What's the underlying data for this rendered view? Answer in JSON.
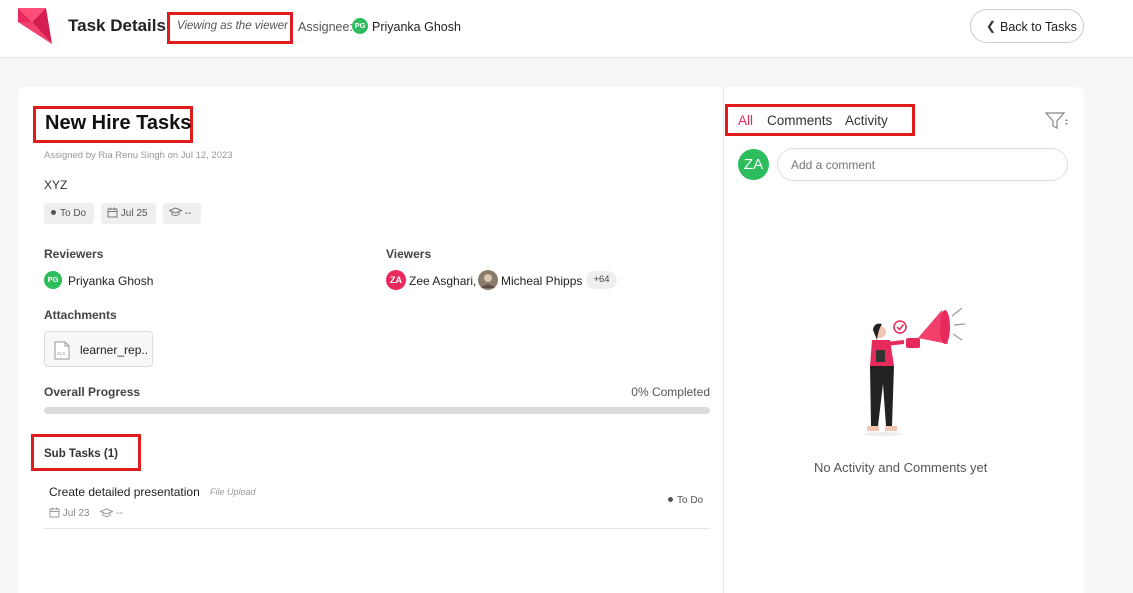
{
  "header": {
    "title": "Task Details",
    "viewing_as": "Viewing as the viewer",
    "assignee_label": "Assignee:",
    "assignee_initials": "PG",
    "assignee_name": "Priyanka Ghosh",
    "back_label": "Back to Tasks"
  },
  "task": {
    "title": "New Hire Tasks",
    "assigned_by": "Assigned by Ria Renu Singh on  Jul 12, 2023",
    "description": "XYZ",
    "status": "To Do",
    "due_date": "Jul 25",
    "course": "--"
  },
  "reviewers": {
    "label": "Reviewers",
    "people": [
      {
        "initials": "PG",
        "name": "Priyanka Ghosh",
        "color": "#2ebd5c"
      }
    ]
  },
  "viewers": {
    "label": "Viewers",
    "people": [
      {
        "initials": "ZA",
        "name": "Zee Asghari,",
        "color": "#e8295c"
      },
      {
        "initials": "",
        "name": "Micheal Phipps",
        "color": "#8a7a6a"
      }
    ],
    "more": "+64"
  },
  "attachments": {
    "label": "Attachments",
    "files": [
      {
        "name": "learner_rep..",
        "ext": "XLS"
      }
    ]
  },
  "progress": {
    "label": "Overall Progress",
    "value_text": "0% Completed",
    "percent": 0
  },
  "subtasks": {
    "label": "Sub Tasks (1)",
    "items": [
      {
        "title": "Create detailed presentation",
        "type": "File Upload",
        "status": "To Do",
        "due_date": "Jul 23",
        "course": "--"
      }
    ]
  },
  "activity": {
    "tabs": [
      {
        "label": "All",
        "active": true
      },
      {
        "label": "Comments",
        "active": false
      },
      {
        "label": "Activity",
        "active": false
      }
    ],
    "user_initials": "ZA",
    "comment_placeholder": "Add a comment",
    "empty_text": "No Activity and Comments yet"
  },
  "colors": {
    "accent": "#e8295c",
    "avatar_green": "#2ebd5c",
    "highlight_red": "#e01b1b"
  }
}
